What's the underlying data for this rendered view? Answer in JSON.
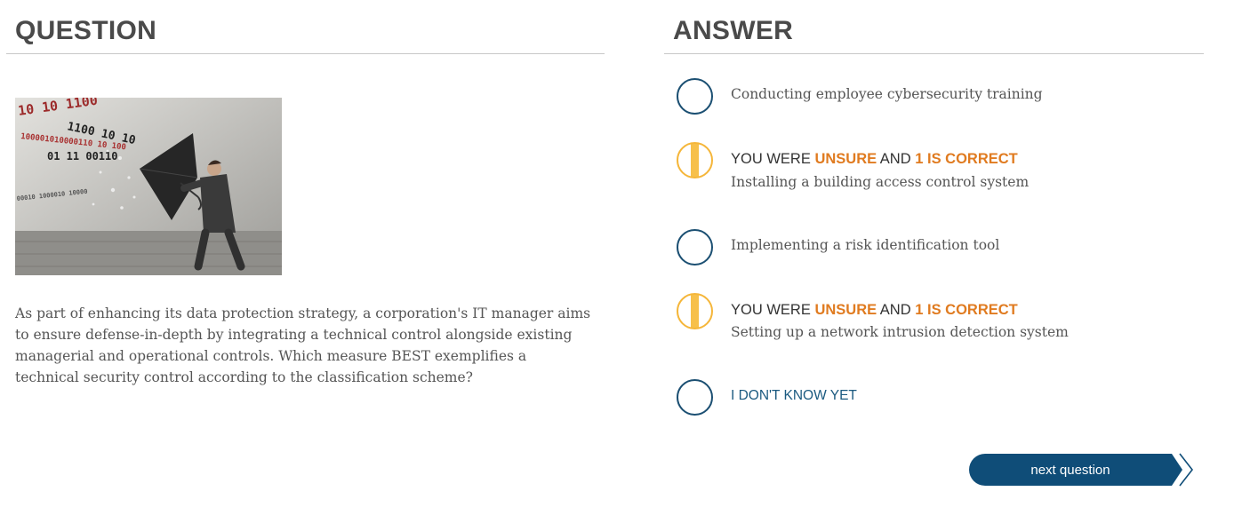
{
  "question": {
    "heading": "QUESTION",
    "text": "As part of enhancing its data protection strategy, a corporation's IT manager aims to ensure defense-in-depth by integrating a technical control alongside existing managerial and operational controls. Which measure BEST exemplifies a technical security control according to the classification scheme?",
    "image": {
      "binary_lines": [
        "10 10 1100",
        "1100 10 10",
        "100001010000110 10 100",
        "01 11 00110",
        "00010 1000010 10000"
      ]
    }
  },
  "answer": {
    "heading": "ANSWER",
    "options": [
      {
        "text": "Conducting employee cybersecurity training"
      },
      {
        "text": "Installing a building access control system",
        "feedback": {
          "prefix": "YOU WERE ",
          "status": "UNSURE",
          "middle": " AND ",
          "verdict": "1 IS CORRECT"
        }
      },
      {
        "text": "Implementing a risk identification tool"
      },
      {
        "text": "Setting up a network intrusion detection system",
        "feedback": {
          "prefix": "YOU WERE ",
          "status": "UNSURE",
          "middle": " AND ",
          "verdict": "1 IS CORRECT"
        }
      }
    ],
    "dont_know": "I DON'T KNOW YET"
  },
  "navigation": {
    "next_label": "next question"
  },
  "colors": {
    "primary": "#0f4d78",
    "highlight": "#e07b20",
    "unsure": "#f7c04a"
  }
}
